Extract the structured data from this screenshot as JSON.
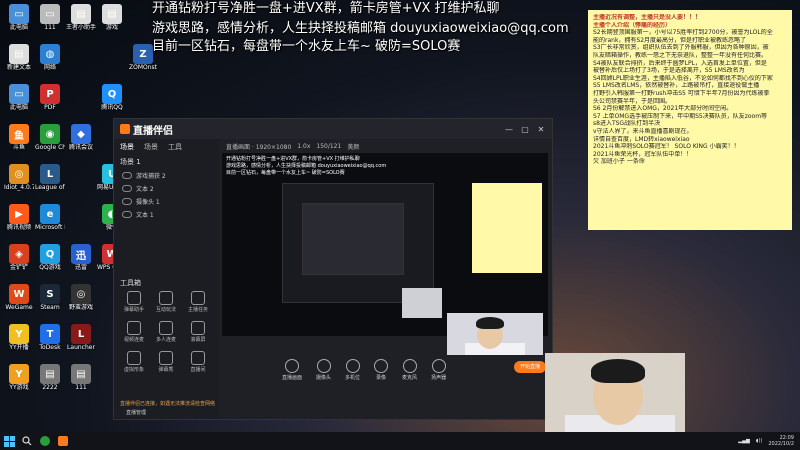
{
  "overlay": {
    "line1": "开通钻粉打号净胜一盘+进VX群，箭卡房管+VX  打维护私聊",
    "line2": "游戏思路，感情分析，人生抉择投稿邮箱 douyuxiaoweixiao@qq.com",
    "line3": "目前一区钻石，每盘带一个水友上车~ 破防=SOLO赛"
  },
  "desktop_icons": [
    {
      "label": "此电脑",
      "glyph": "▭",
      "color": "#4a90d9"
    },
    {
      "label": "111",
      "glyph": "▭",
      "color": "#bbbbbb"
    },
    {
      "label": "王者小助手",
      "glyph": "▤",
      "color": "#dddddd"
    },
    {
      "label": "游戏",
      "glyph": "▤",
      "color": "#dddddd"
    },
    {
      "label": "新建文本",
      "glyph": "▤",
      "color": "#dddddd"
    },
    {
      "label": "网络",
      "glyph": "◍",
      "color": "#2d7fd3"
    },
    {
      "label": "此电脑",
      "glyph": "▭",
      "color": "#4a90d9"
    },
    {
      "label": "PDF",
      "glyph": "P",
      "color": "#d03030"
    },
    {
      "label": "腾讯QQ",
      "glyph": "Q",
      "color": "#1e90ff"
    },
    {
      "label": "斗鱼",
      "glyph": "鱼",
      "color": "#ff7a1a"
    },
    {
      "label": "Google Chrome",
      "glyph": "◉",
      "color": "#2a9d3c"
    },
    {
      "label": "腾讯会议",
      "glyph": "◆",
      "color": "#2f6fe0"
    },
    {
      "label": "Idiot_4.0.78",
      "glyph": "◎",
      "color": "#e09020"
    },
    {
      "label": "League of Legends",
      "glyph": "L",
      "color": "#2a5a8a"
    },
    {
      "label": "网易UU加速器",
      "glyph": "U",
      "color": "#27c0e0"
    },
    {
      "label": "腾讯视频",
      "glyph": "▶",
      "color": "#ff5a1a"
    },
    {
      "label": "Microsoft Edge",
      "glyph": "e",
      "color": "#1f8ad8"
    },
    {
      "label": "微信",
      "glyph": "◐",
      "color": "#2bb24c"
    },
    {
      "label": "金铲铲",
      "glyph": "◈",
      "color": "#d94020"
    },
    {
      "label": "QQ游戏",
      "glyph": "Q",
      "color": "#20a0e0"
    },
    {
      "label": "迅雷",
      "glyph": "迅",
      "color": "#2a60d0"
    },
    {
      "label": "WPS Office",
      "glyph": "W",
      "color": "#d03030"
    },
    {
      "label": "WeGame",
      "glyph": "W",
      "color": "#e04a1a"
    },
    {
      "label": "Steam",
      "glyph": "S",
      "color": "#1b2838"
    },
    {
      "label": "野蛮游戏",
      "glyph": "◎",
      "color": "#333333"
    },
    {
      "label": "YY开播",
      "glyph": "Y",
      "color": "#f0c020"
    },
    {
      "label": "ToDesk",
      "glyph": "T",
      "color": "#1f6feb"
    },
    {
      "label": "Launcher",
      "glyph": "L",
      "color": "#8a1a1a"
    },
    {
      "label": "YY游戏",
      "glyph": "Y",
      "color": "#f0a020"
    },
    {
      "label": "2222",
      "glyph": "▤",
      "color": "#777777"
    },
    {
      "label": "111",
      "glyph": "▤",
      "color": "#777777"
    },
    {
      "label": "ZOMOnst",
      "glyph": "Z",
      "color": "#2a60b0"
    }
  ],
  "sticky_note": {
    "lines": [
      "主播近况有调整，主播只是没人要！！！",
      "主播个人介绍（悸痛的经历）",
      "S2长期登顶国服第一，小号以75胜率打到2700分，被誉为LOL的全",
      "能的rank，拥有S2月度最高分，但是打职业被教练忽略了",
      "S3厂长非常欣赏，组织队伍去到了外服韩服，但因为各种原因，被",
      "队友暗箱操作，教练一怒之下无奈退队，整整一年没有任何比赛。",
      "S4被队友联合排挤，后来终于圆梦LPL，入选首发上单位置，但是",
      "被替补后仅上场打了3场，于是选择离开，S5 LMS改名为",
      "S4回顾LPL职业生涯，主播陷入低谷，不论如何都找不到心仪的下家",
      "S5 LMS改名LMS，依然被替补，上路被吊打，直接退役做主播",
      "打野引入韩服第一打野rush冲击S5 可惜下半年7月份因为代练被拳",
      "头公司禁赛半年，于是回国。",
      "S6 2月份解禁进入OMG，2021年大部分时间空闲。",
      "S7 上单OMG选手被压制下来，年中期S5决赛队员，队友zoom等",
      "s8进入TSG战队打到半决",
      "v守法人界了，来斗鱼直播喜剧现在。",
      "详情自查百度，LMD转xiaoweixiao",
      "2021斗鱼冲刺SOLO赛冠军！ SOLO KING 小霸笑！！",
      "2021斗鱼荣光杯，冠军队伍中单！！",
      "欠  加班小子    一条命"
    ]
  },
  "app": {
    "name": "直播伴侣",
    "window_controls": [
      "—",
      "▢",
      "✕"
    ],
    "tabs": [
      "场景",
      "场景",
      "工具"
    ],
    "scene_label": "场景 1",
    "sources": [
      "游戏捕获 2",
      "文本 2",
      "摄像头 1",
      "文本 1"
    ],
    "tools_title": "工具箱",
    "tools": [
      "弹幕助手",
      "互动玩法",
      "主播任务",
      "视频连麦",
      "多人连麦",
      "滚幕屏",
      "虚拟形象",
      "弹幕秀",
      "直播间"
    ],
    "preview_bar": [
      "直播画面 · 1920×1080",
      "1.0x",
      "150/121",
      "美颜"
    ],
    "controls": [
      "直播画面",
      "摄像头",
      "多机位",
      "录像",
      "麦克风",
      "扬声器"
    ],
    "live_button": "开始直播",
    "bottom_tip": "直播伴侣已连接，如遇无法推流请检查网络，建议使用有线网络直播效果更佳",
    "bottom_menu": "直播管理"
  },
  "taskbar": {
    "start_icon": "windows-icon",
    "time": "22:09",
    "date": "2022/10/2"
  }
}
